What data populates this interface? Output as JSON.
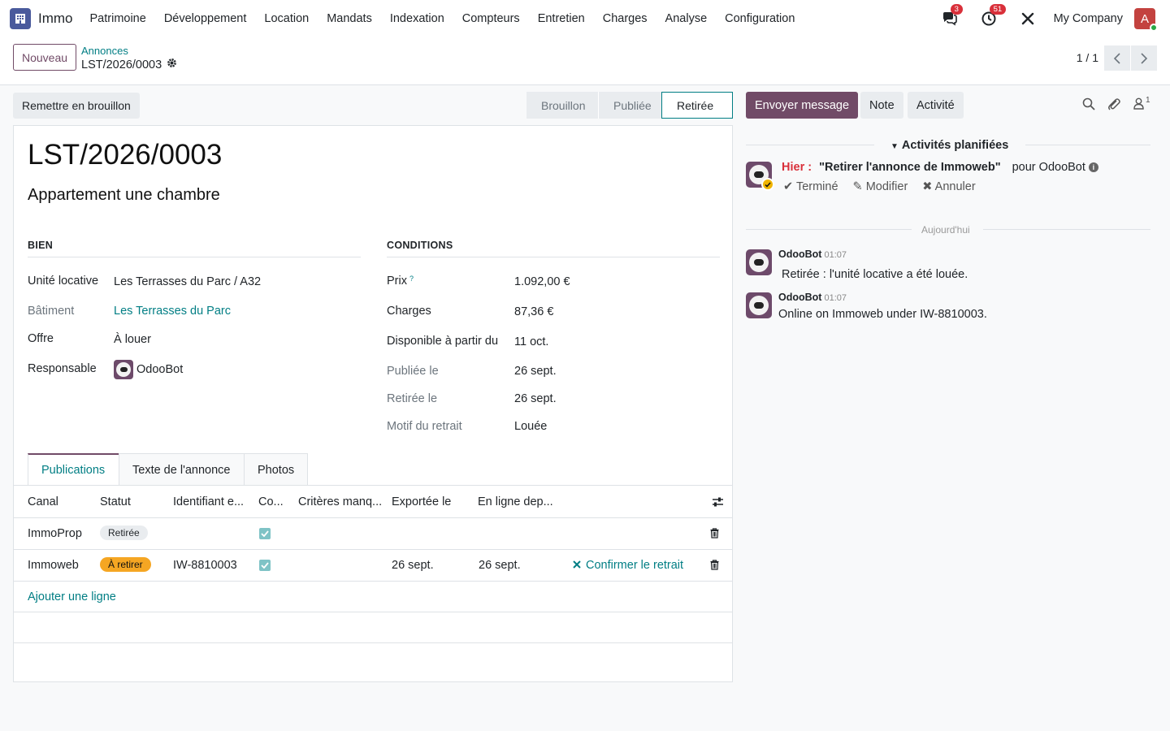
{
  "nav": {
    "app_name": "Immo",
    "menu": [
      "Patrimoine",
      "Développement",
      "Location",
      "Mandats",
      "Indexation",
      "Compteurs",
      "Entretien",
      "Charges",
      "Analyse",
      "Configuration"
    ],
    "messages_badge": "3",
    "activities_badge": "51",
    "company": "My Company",
    "user_initial": "A"
  },
  "cpanel": {
    "new_label": "Nouveau",
    "breadcrumb_parent": "Annonces",
    "breadcrumb_current": "LST/2026/0003",
    "pager": "1 / 1"
  },
  "actions": {
    "draft_label": "Remettre en brouillon",
    "stages": [
      "Brouillon",
      "Publiée",
      "Retirée"
    ],
    "active_stage": "Retirée"
  },
  "record": {
    "title": "LST/2026/0003",
    "subtitle": "Appartement une chambre",
    "bien": {
      "group_title": "BIEN",
      "unite_label": "Unité locative",
      "unite_value": "Les Terrasses du Parc / A32",
      "batiment_label": "Bâtiment",
      "batiment_value": "Les Terrasses du Parc",
      "offre_label": "Offre",
      "offre_value": "À louer",
      "resp_label": "Responsable",
      "resp_value": "OdooBot"
    },
    "conditions": {
      "group_title": "CONDITIONS",
      "prix_label": "Prix",
      "prix_help": "?",
      "prix_value": "1.092,00 €",
      "charges_label": "Charges",
      "charges_value": "87,36 €",
      "dispo_label": "Disponible à partir du",
      "dispo_value": "11 oct.",
      "publiee_label": "Publiée le",
      "publiee_value": "26 sept.",
      "retiree_label": "Retirée le",
      "retiree_value": "26 sept.",
      "motif_label": "Motif du retrait",
      "motif_value": "Louée"
    }
  },
  "tabs": [
    "Publications",
    "Texte de l'annonce",
    "Photos"
  ],
  "table": {
    "headers": [
      "Canal",
      "Statut",
      "Identifiant e...",
      "Co...",
      "Critères manq...",
      "Exportée le",
      "En ligne dep..."
    ],
    "rows": [
      {
        "canal": "ImmoProp",
        "statut": "Retirée",
        "identifiant": "",
        "exportee": "",
        "en_ligne": "",
        "action": ""
      },
      {
        "canal": "Immoweb",
        "statut": "À retirer",
        "identifiant": "IW-8810003",
        "exportee": "26 sept.",
        "en_ligne": "26 sept.",
        "action": "Confirmer le retrait"
      }
    ],
    "add_line": "Ajouter une ligne"
  },
  "chatter": {
    "send_label": "Envoyer message",
    "note_label": "Note",
    "activity_label": "Activité",
    "followers_count": "1",
    "planned_header": "Activités planifiées",
    "activity": {
      "when": "Hier :",
      "summary": "\"Retirer l'annonce de Immoweb\"",
      "for": "pour OdooBot",
      "done": "Terminé",
      "edit": "Modifier",
      "cancel": "Annuler"
    },
    "today_label": "Aujourd'hui",
    "messages": [
      {
        "author": "OdooBot",
        "time": "01:07",
        "body": "Retirée : l'unité locative a été louée."
      },
      {
        "author": "OdooBot",
        "time": "01:07",
        "body": "Online on Immoweb under IW-8810003."
      }
    ]
  },
  "colors": {
    "primary": "#714b67",
    "link": "#017e84",
    "badge_red": "#d9303a",
    "warning": "#f5a623"
  }
}
